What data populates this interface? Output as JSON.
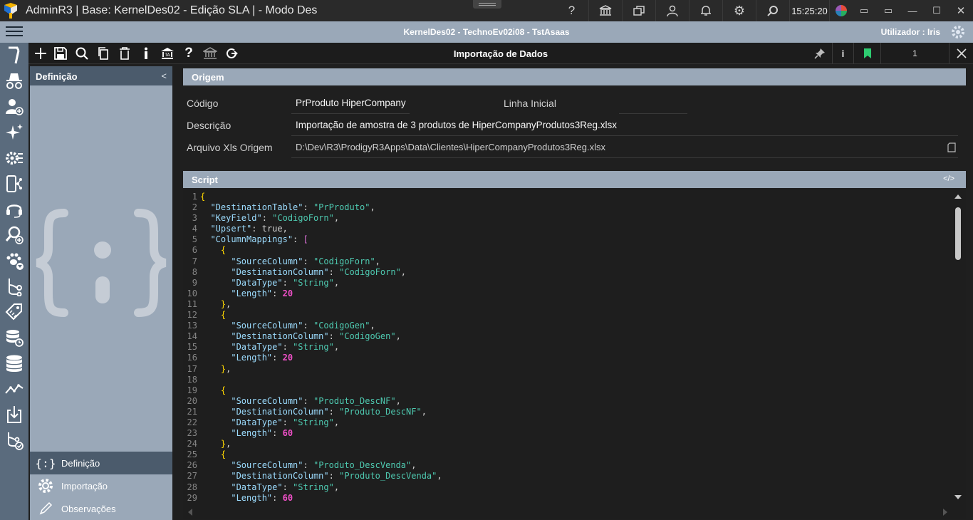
{
  "window": {
    "title": "AdminR3 | Base: KernelDes02 - Edição SLA | - Modo Des",
    "clock": "15:25:20"
  },
  "session": {
    "center_text": "KernelDes02 - TechnoEv02i08 - TstAsaas",
    "user_text": "Utilizador : Iris"
  },
  "toolbar": {
    "title": "Importação de Dados",
    "page_number": "1",
    "info_label": "i"
  },
  "definition_panel": {
    "header": "Definição",
    "collapse_glyph": "<",
    "nav": [
      {
        "label": "Definição",
        "icon": "{:}",
        "active": true
      },
      {
        "label": "Importação",
        "icon": "gear-icon",
        "active": false
      },
      {
        "label": "Observações",
        "icon": "pencil-icon",
        "active": false
      }
    ]
  },
  "origem": {
    "header": "Origem",
    "codigo_label": "Código",
    "codigo_value": "PrProduto HiperCompany",
    "linha_inicial_label": "Linha Inicial",
    "linha_inicial_value": "",
    "descricao_label": "Descrição",
    "descricao_value": "Importação de amostra de 3 produtos de HiperCompanyProdutos3Reg.xlsx",
    "arquivo_label": "Arquivo Xls Origem",
    "arquivo_value": "D:\\Dev\\R3\\ProdigyR3Apps\\Data\\Clientes\\HiperCompanyProdutos3Reg.xlsx"
  },
  "script": {
    "header": "Script",
    "code_icon": "</>",
    "lines": [
      "{",
      "  \"DestinationTable\": \"PrProduto\",",
      "  \"KeyField\": \"CodigoForn\",",
      "  \"Upsert\": true,",
      "  \"ColumnMappings\": [",
      "    {",
      "      \"SourceColumn\": \"CodigoForn\",",
      "      \"DestinationColumn\": \"CodigoForn\",",
      "      \"DataType\": \"String\",",
      "      \"Length\": 20",
      "    },",
      "    {",
      "      \"SourceColumn\": \"CodigoGen\",",
      "      \"DestinationColumn\": \"CodigoGen\",",
      "      \"DataType\": \"String\",",
      "      \"Length\": 20",
      "    },",
      "",
      "    {",
      "      \"SourceColumn\": \"Produto_DescNF\",",
      "      \"DestinationColumn\": \"Produto_DescNF\",",
      "      \"DataType\": \"String\",",
      "      \"Length\": 60",
      "    },",
      "    {",
      "      \"SourceColumn\": \"Produto_DescVenda\",",
      "      \"DestinationColumn\": \"Produto_DescVenda\",",
      "      \"DataType\": \"String\",",
      "      \"Length\": 60"
    ]
  },
  "colors": {
    "rail": "#5a6b7d",
    "panel": "#9aa8b8",
    "panel_dark": "#4b5b6c",
    "key": "#9cdcfe",
    "string": "#4ec9b0",
    "number": "#f050c8",
    "bookmark": "#2ecc71"
  }
}
